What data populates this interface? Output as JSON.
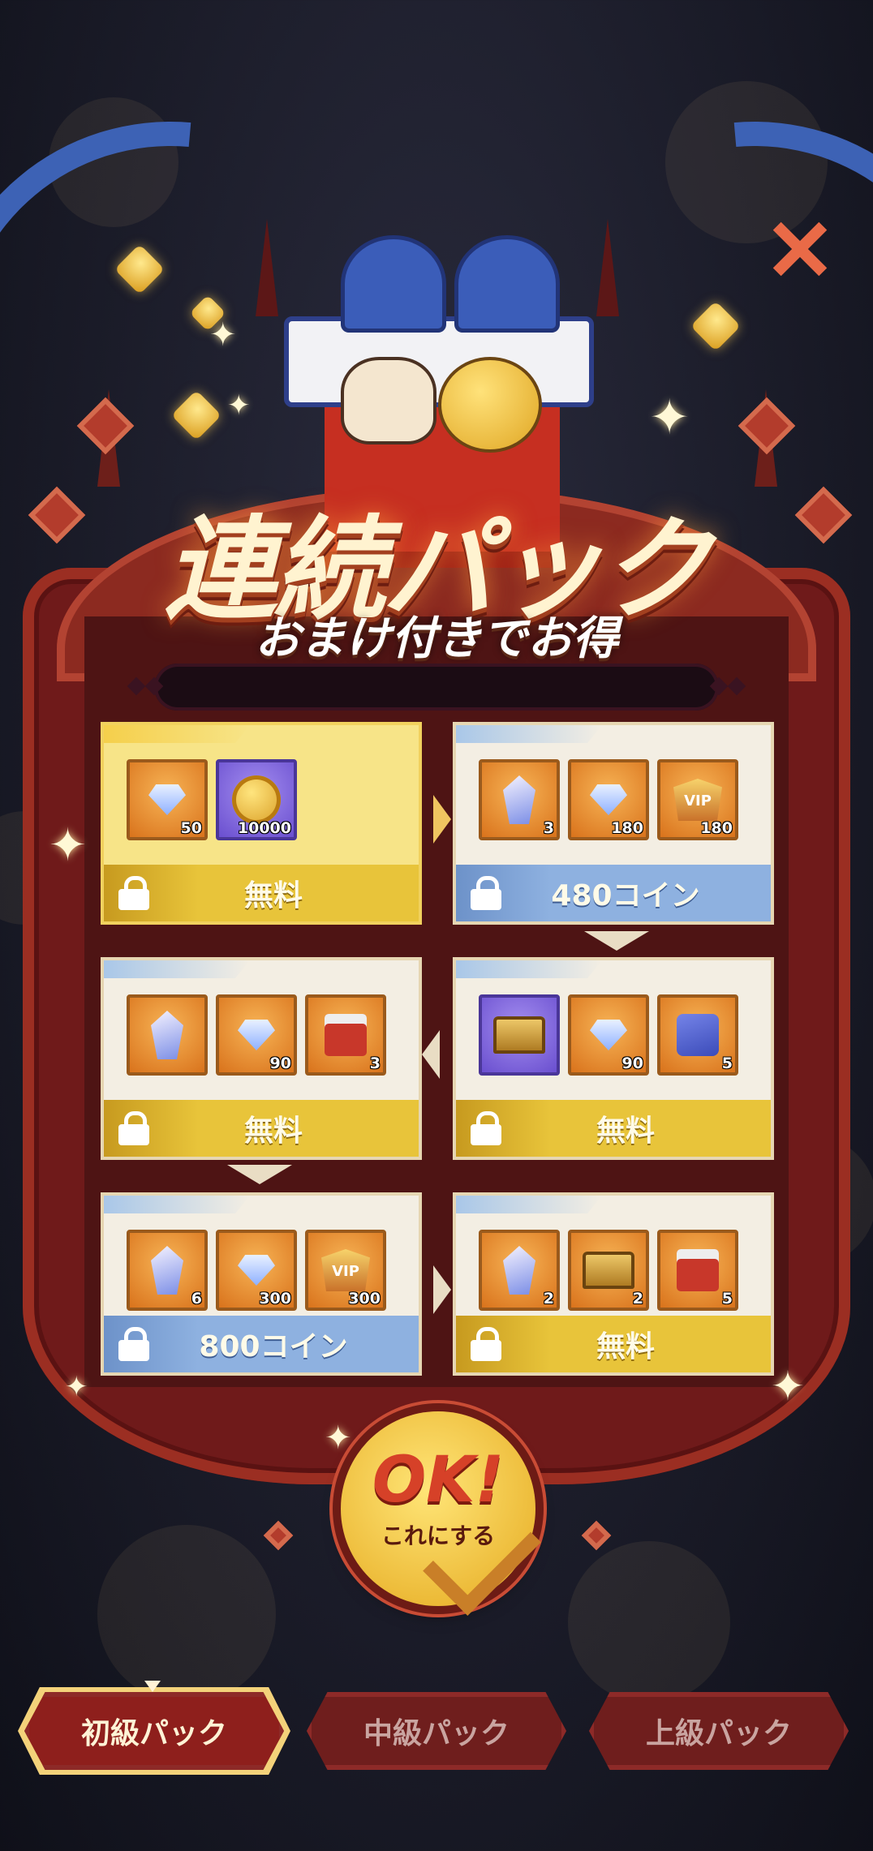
{
  "header": {
    "title": "連続パック",
    "subtitle": "おまけ付きでお得"
  },
  "close_icon": "close-x-icon",
  "packs": [
    {
      "price": "無料",
      "price_style": "gold",
      "active": true,
      "items": [
        {
          "icon": "diamond-gem-icon",
          "count": "50"
        },
        {
          "icon": "gold-coin-icon",
          "count": "10000",
          "bg": "purple"
        }
      ]
    },
    {
      "price": "480コイン",
      "price_style": "blue",
      "items": [
        {
          "icon": "crystal-icon",
          "count": "3"
        },
        {
          "icon": "diamond-gem-icon",
          "count": "180"
        },
        {
          "icon": "vip-badge-icon",
          "count": "180"
        }
      ]
    },
    {
      "price": "無料",
      "price_style": "gold",
      "items": [
        {
          "icon": "crystal-icon",
          "count": ""
        },
        {
          "icon": "diamond-gem-icon",
          "count": "90"
        },
        {
          "icon": "red-box-icon",
          "count": "3"
        }
      ]
    },
    {
      "price": "無料",
      "price_style": "gold",
      "items": [
        {
          "icon": "treasure-chest-icon",
          "count": "",
          "bg": "purple"
        },
        {
          "icon": "diamond-gem-icon",
          "count": "90"
        },
        {
          "icon": "puzzle-piece-icon",
          "count": "5"
        }
      ]
    },
    {
      "price": "800コイン",
      "price_style": "blue",
      "items": [
        {
          "icon": "crystal-icon",
          "count": "6"
        },
        {
          "icon": "diamond-gem-icon",
          "count": "300"
        },
        {
          "icon": "vip-badge-icon",
          "count": "300"
        }
      ]
    },
    {
      "price": "無料",
      "price_style": "gold",
      "items": [
        {
          "icon": "crystal-icon",
          "count": "2"
        },
        {
          "icon": "treasure-chest-icon",
          "count": "2"
        },
        {
          "icon": "red-box-icon",
          "count": "5"
        }
      ]
    }
  ],
  "ok_button": {
    "label": "OK!",
    "sublabel": "これにする"
  },
  "tabs": [
    {
      "label": "初級パック",
      "active": true
    },
    {
      "label": "中級パック",
      "active": false
    },
    {
      "label": "上級パック",
      "active": false
    }
  ],
  "colors": {
    "accent_gold": "#e8c43a",
    "frame_red": "#6f1a1a",
    "price_blue": "#8eb1e0"
  }
}
